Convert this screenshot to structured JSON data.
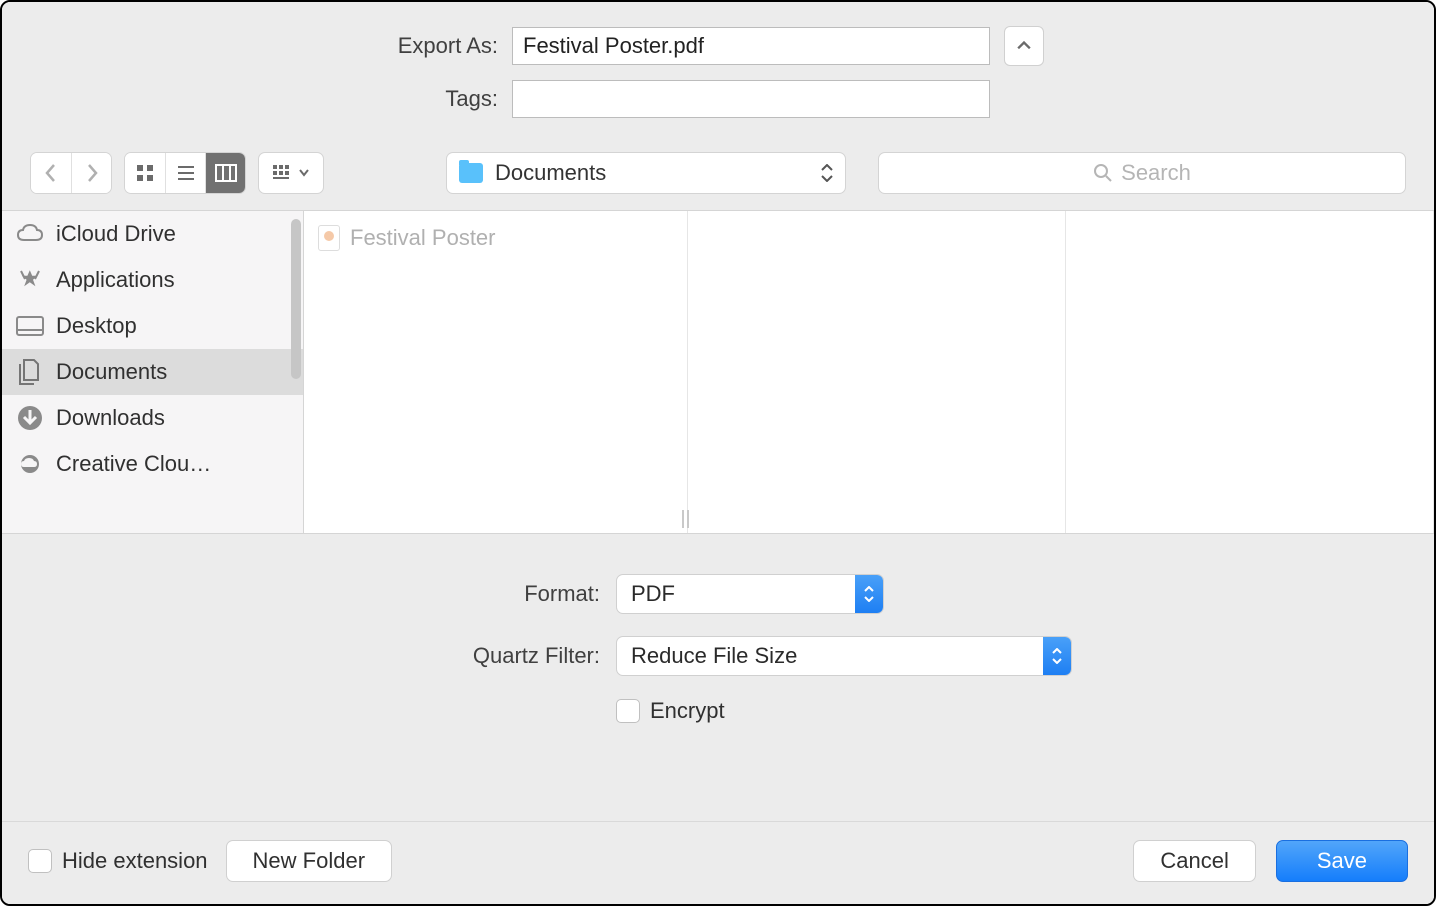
{
  "header": {
    "export_as_label": "Export As:",
    "export_as_value": "Festival Poster.pdf",
    "tags_label": "Tags:",
    "tags_value": ""
  },
  "toolbar": {
    "location": "Documents",
    "search_placeholder": "Search"
  },
  "sidebar": {
    "items": [
      {
        "label": "iCloud Drive",
        "icon": "cloud"
      },
      {
        "label": "Applications",
        "icon": "app"
      },
      {
        "label": "Desktop",
        "icon": "desktop"
      },
      {
        "label": "Documents",
        "icon": "documents",
        "selected": true
      },
      {
        "label": "Downloads",
        "icon": "downloads"
      },
      {
        "label": "Creative Clou…",
        "icon": "cc"
      }
    ]
  },
  "columns": {
    "col1_items": [
      {
        "label": "Festival Poster"
      }
    ]
  },
  "options": {
    "format_label": "Format:",
    "format_value": "PDF",
    "quartz_label": "Quartz Filter:",
    "quartz_value": "Reduce File Size",
    "encrypt_label": "Encrypt"
  },
  "footer": {
    "hide_extension_label": "Hide extension",
    "new_folder_label": "New Folder",
    "cancel_label": "Cancel",
    "save_label": "Save"
  }
}
